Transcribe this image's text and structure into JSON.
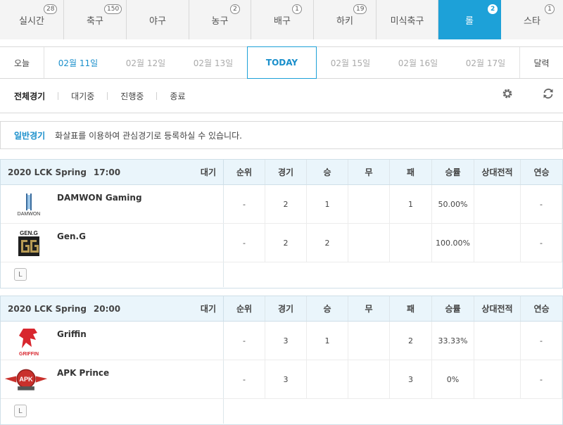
{
  "sport_tabs": [
    {
      "label": "실시간",
      "badge": "28",
      "active": false
    },
    {
      "label": "축구",
      "badge": "150",
      "active": false
    },
    {
      "label": "야구",
      "badge": "",
      "active": false
    },
    {
      "label": "농구",
      "badge": "2",
      "active": false
    },
    {
      "label": "배구",
      "badge": "1",
      "active": false
    },
    {
      "label": "하키",
      "badge": "19",
      "active": false
    },
    {
      "label": "미식축구",
      "badge": "",
      "active": false
    },
    {
      "label": "롤",
      "badge": "2",
      "active": true
    },
    {
      "label": "스타",
      "badge": "1",
      "active": false
    }
  ],
  "date_bar": {
    "today_label": "오늘",
    "dates": [
      "02월 11일",
      "02월 12일",
      "02월 13일",
      "TODAY",
      "02월 15일",
      "02월 16일",
      "02월 17일"
    ],
    "calendar_label": "달력"
  },
  "filters": {
    "items": [
      "전체경기",
      "대기중",
      "진행중",
      "종료"
    ],
    "active_index": 0
  },
  "info": {
    "label": "일반경기",
    "text": "화살표를 이용하여 관심경기로 등록하실 수 있습니다."
  },
  "columns": [
    "순위",
    "경기",
    "승",
    "무",
    "패",
    "승률",
    "상대전적",
    "연승"
  ],
  "matches": [
    {
      "league": "2020 LCK Spring",
      "time": "17:00",
      "status": "대기",
      "teams": [
        {
          "name": "DAMWON Gaming",
          "logo_text": "DAMWON",
          "rank": "-",
          "games": "2",
          "win": "1",
          "draw": "",
          "loss": "1",
          "rate": "50.00%",
          "h2h": "",
          "streak": "-"
        },
        {
          "name": "Gen.G",
          "logo_text": "GEN.G",
          "rank": "-",
          "games": "2",
          "win": "2",
          "draw": "",
          "loss": "",
          "rate": "100.00%",
          "h2h": "",
          "streak": "-"
        }
      ]
    },
    {
      "league": "2020 LCK Spring",
      "time": "20:00",
      "status": "대기",
      "teams": [
        {
          "name": "Griffin",
          "logo_text": "GRIFFIN",
          "rank": "-",
          "games": "3",
          "win": "1",
          "draw": "",
          "loss": "2",
          "rate": "33.33%",
          "h2h": "",
          "streak": "-"
        },
        {
          "name": "APK Prince",
          "logo_text": "APK",
          "rank": "-",
          "games": "3",
          "win": "",
          "draw": "",
          "loss": "3",
          "rate": "0%",
          "h2h": "",
          "streak": "-"
        }
      ]
    }
  ],
  "lineup_icon_label": "L",
  "colors": {
    "accent": "#1da1d8",
    "link": "#1a8fcb",
    "header_bg": "#eaf5fb"
  }
}
